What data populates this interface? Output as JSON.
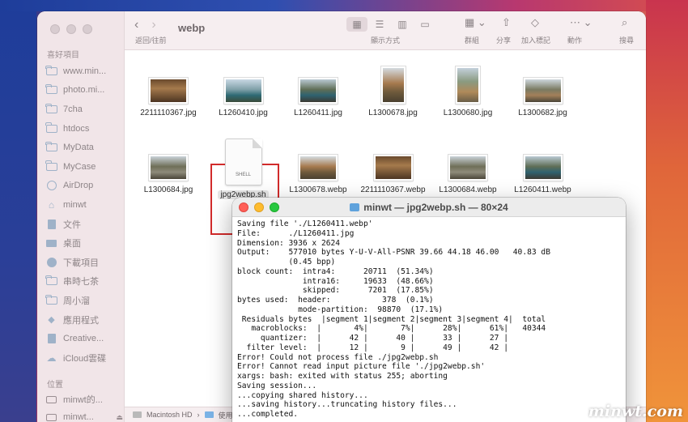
{
  "finder": {
    "sidebar": {
      "favorites_title": "喜好項目",
      "items": [
        {
          "label": "www.min...",
          "icon": "folder-icon"
        },
        {
          "label": "photo.mi...",
          "icon": "folder-icon"
        },
        {
          "label": "7cha",
          "icon": "folder-icon"
        },
        {
          "label": "htdocs",
          "icon": "folder-icon"
        },
        {
          "label": "MyData",
          "icon": "folder-icon"
        },
        {
          "label": "MyCase",
          "icon": "folder-icon"
        },
        {
          "label": "AirDrop",
          "icon": "airdrop-icon"
        },
        {
          "label": "minwt",
          "icon": "home-icon"
        },
        {
          "label": "文件",
          "icon": "document-icon"
        },
        {
          "label": "桌面",
          "icon": "desktop-icon"
        },
        {
          "label": "下載項目",
          "icon": "download-icon"
        },
        {
          "label": "串時七茶",
          "icon": "folder-icon"
        },
        {
          "label": "周小溜",
          "icon": "folder-icon"
        },
        {
          "label": "應用程式",
          "icon": "applications-icon"
        },
        {
          "label": "Creative...",
          "icon": "document-icon"
        },
        {
          "label": "iCloud雲碟",
          "icon": "cloud-icon"
        }
      ],
      "locations_title": "位置",
      "locations": [
        {
          "label": "minwt的..."
        },
        {
          "label": "minwt..."
        }
      ]
    },
    "toolbar": {
      "title": "webp",
      "nav_label": "返回/往前",
      "view_label": "顯示方式",
      "group_label": "群組",
      "share_label": "分享",
      "tag_label": "加入標記",
      "action_label": "動作",
      "search_label": "搜尋"
    },
    "files": [
      {
        "name": "2211110367.jpg",
        "kind": "photo"
      },
      {
        "name": "L1260410.jpg",
        "kind": "photo"
      },
      {
        "name": "L1260411.jpg",
        "kind": "photo"
      },
      {
        "name": "L1300678.jpg",
        "kind": "photo"
      },
      {
        "name": "L1300680.jpg",
        "kind": "photo"
      },
      {
        "name": "L1300682.jpg",
        "kind": "photo"
      },
      {
        "name": "L1300684.jpg",
        "kind": "photo"
      },
      {
        "name": "jpg2webp.sh",
        "kind": "shell",
        "badge": "SHELL"
      },
      {
        "name": "L1300678.webp",
        "kind": "photo"
      },
      {
        "name": "2211110367.webp",
        "kind": "photo"
      },
      {
        "name": "L1300684.webp",
        "kind": "photo"
      },
      {
        "name": "L1260411.webp",
        "kind": "photo"
      }
    ],
    "pathbar": {
      "disk": "Macintosh HD",
      "next": "使用"
    }
  },
  "terminal": {
    "title": "minwt — jpg2webp.sh — 80×24",
    "lines": [
      "Saving file './L1260411.webp'",
      "File:      ./L1260411.jpg",
      "Dimension: 3936 x 2624",
      "Output:    577010 bytes Y-U-V-All-PSNR 39.66 44.18 46.00   40.83 dB",
      "           (0.45 bpp)",
      "block count:  intra4:      20711  (51.34%)",
      "              intra16:     19633  (48.66%)",
      "              skipped:      7201  (17.85%)",
      "bytes used:  header:           378  (0.1%)",
      "             mode-partition:  98870  (17.1%)",
      " Residuals bytes  |segment 1|segment 2|segment 3|segment 4|  total",
      "   macroblocks:  |       4%|       7%|      28%|      61%|   40344",
      "     quantizer:  |      42 |      40 |      33 |      27 |",
      "  filter level:  |      12 |       9 |      49 |      42 |",
      "Error! Could not process file ./jpg2webp.sh",
      "Error! Cannot read input picture file './jpg2webp.sh'",
      "xargs: bash: exited with status 255; aborting",
      "Saving session...",
      "...copying shared history...",
      "...saving history...truncating history files...",
      "...completed."
    ]
  },
  "watermark": "minwt.com",
  "colors": {
    "selection_border": "#d22b2b",
    "sidebar_bg": "#f1e5e8",
    "terminal_text": "#111111"
  }
}
